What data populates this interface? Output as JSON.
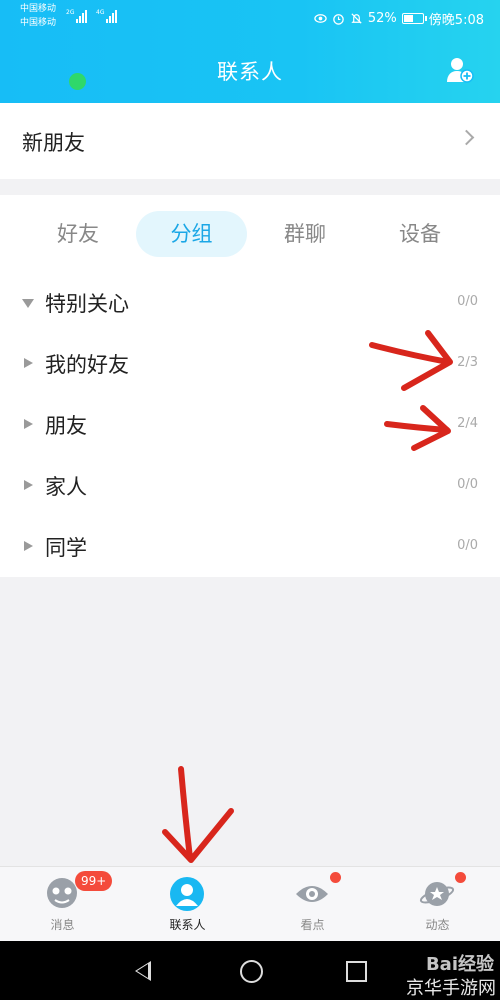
{
  "status_bar": {
    "carrier1": "中国移动",
    "carrier2": "中国移动",
    "net1": "2G",
    "net2": "4G",
    "battery_pct": "52%",
    "battery_level": 0.52,
    "time": "傍晚5:08"
  },
  "header": {
    "title": "联系人"
  },
  "new_friends": {
    "label": "新朋友"
  },
  "tabs": [
    {
      "label": "好友",
      "active": false
    },
    {
      "label": "分组",
      "active": true
    },
    {
      "label": "群聊",
      "active": false
    },
    {
      "label": "设备",
      "active": false
    }
  ],
  "groups": [
    {
      "name": "特别关心",
      "count": "0/0",
      "expanded": true
    },
    {
      "name": "我的好友",
      "count": "2/3",
      "expanded": false
    },
    {
      "name": "朋友",
      "count": "2/4",
      "expanded": false
    },
    {
      "name": "家人",
      "count": "0/0",
      "expanded": false
    },
    {
      "name": "同学",
      "count": "0/0",
      "expanded": false
    }
  ],
  "bottom_nav": [
    {
      "label": "消息",
      "badge": "99+",
      "icon": "message-icon"
    },
    {
      "label": "联系人",
      "active": true,
      "icon": "contacts-icon"
    },
    {
      "label": "看点",
      "dot": true,
      "icon": "eye-icon"
    },
    {
      "label": "动态",
      "dot": true,
      "icon": "planet-icon"
    }
  ],
  "watermark": {
    "line1": "Bai经验",
    "line2": "京华手游网"
  },
  "colors": {
    "accent": "#1ba7e6",
    "header": "#17bdf6",
    "badge": "#f44b3b",
    "annotation": "#d8261c"
  }
}
